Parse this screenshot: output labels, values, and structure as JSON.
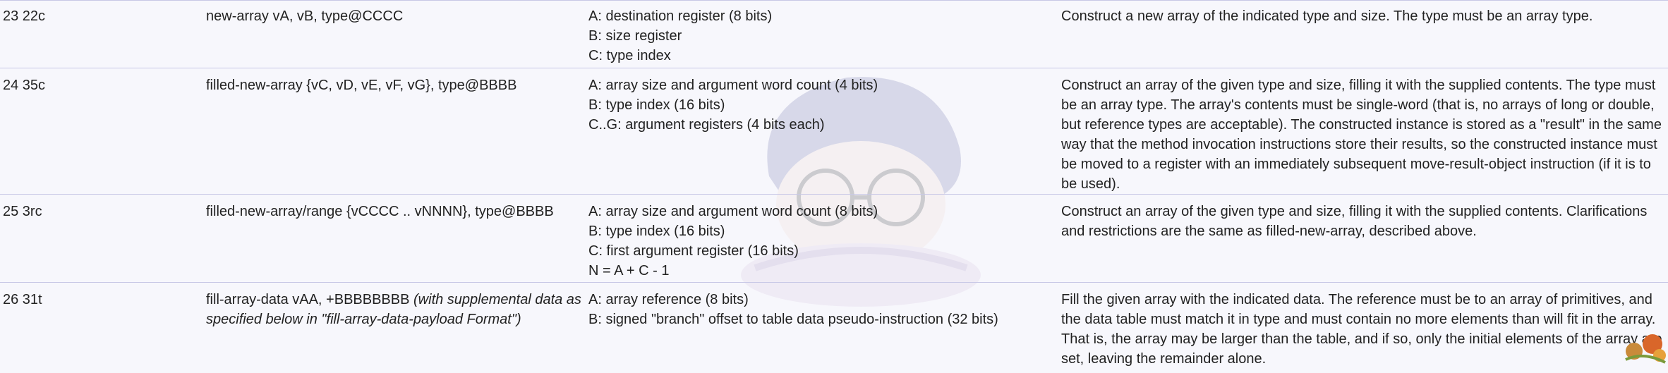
{
  "rows": [
    {
      "opcode": "23 22c",
      "format": "new-array vA, vB, type@CCCC",
      "format_note": "",
      "args": [
        "A: destination register (8 bits)",
        "B: size register",
        "C: type index"
      ],
      "description": "Construct a new array of the indicated type and size. The type must be an array type."
    },
    {
      "opcode": "24 35c",
      "format": "filled-new-array {vC, vD, vE, vF, vG}, type@BBBB",
      "format_note": "",
      "args": [
        "A: array size and argument word count (4 bits)",
        "B: type index (16 bits)",
        "C..G: argument registers (4 bits each)"
      ],
      "description": "Construct an array of the given type and size, filling it with the supplied contents. The type must be an array type. The array's contents must be single-word (that is, no arrays of long or double, but reference types are acceptable). The constructed instance is stored as a \"result\" in the same way that the method invocation instructions store their results, so the constructed instance must be moved to a register with an immediately subsequent move-result-object instruction (if it is to be used)."
    },
    {
      "opcode": "25 3rc",
      "format": "filled-new-array/range {vCCCC .. vNNNN}, type@BBBB",
      "format_note": "",
      "args": [
        "A: array size and argument word count (8 bits)",
        "B: type index (16 bits)",
        "C: first argument register (16 bits)",
        "N = A + C - 1"
      ],
      "description": "Construct an array of the given type and size, filling it with the supplied contents. Clarifications and restrictions are the same as filled-new-array, described above."
    },
    {
      "opcode": "26 31t",
      "format": "fill-array-data vAA, +BBBBBBBB",
      "format_note": "(with supplemental data as specified below in \"fill-array-data-payload Format\")",
      "args": [
        "A: array reference (8 bits)",
        "B: signed \"branch\" offset to table data pseudo-instruction (32 bits)"
      ],
      "description": "Fill the given array with the indicated data. The reference must be to an array of primitives, and the data table must match it in type and must contain no more elements than will fit in the array. That is, the array may be larger than the table, and if so, only the initial elements of the array are set, leaving the remainder alone."
    }
  ]
}
